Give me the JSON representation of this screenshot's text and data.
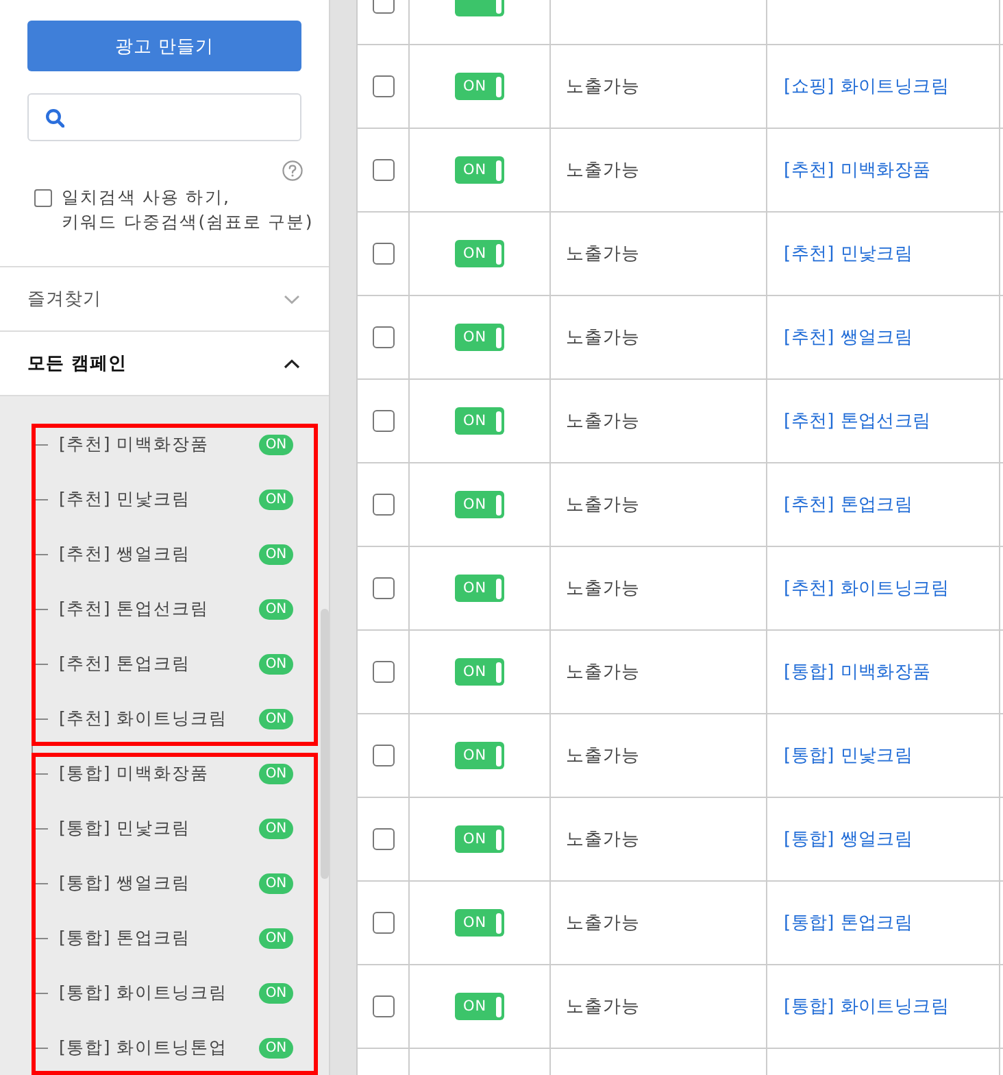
{
  "sidebar": {
    "create_button": "광고 만들기",
    "exact_match": {
      "checked": false,
      "label_lines": [
        "일치검색 사용 하기,",
        "키워드 다중검색(쉼표로 구분)"
      ]
    },
    "sections": [
      {
        "label": "즐겨찾기",
        "expanded": false
      },
      {
        "label": "모든 캠페인",
        "expanded": true,
        "campaign_groups": [
          {
            "highlighted": true,
            "items": [
              {
                "name": "[추천] 미백화장품",
                "on": true,
                "badge": "ON"
              },
              {
                "name": "[추천] 민낯크림",
                "on": true,
                "badge": "ON"
              },
              {
                "name": "[추천] 쌩얼크림",
                "on": true,
                "badge": "ON"
              },
              {
                "name": "[추천] 톤업선크림",
                "on": true,
                "badge": "ON"
              },
              {
                "name": "[추천] 톤업크림",
                "on": true,
                "badge": "ON"
              },
              {
                "name": "[추천] 화이트닝크림",
                "on": true,
                "badge": "ON"
              }
            ]
          },
          {
            "highlighted": true,
            "items": [
              {
                "name": "[통합] 미백화장품",
                "on": true,
                "badge": "ON"
              },
              {
                "name": "[통합] 민낯크림",
                "on": true,
                "badge": "ON"
              },
              {
                "name": "[통합] 쌩얼크림",
                "on": true,
                "badge": "ON"
              },
              {
                "name": "[통합] 톤업크림",
                "on": true,
                "badge": "ON"
              },
              {
                "name": "[통합] 화이트닝크림",
                "on": true,
                "badge": "ON"
              },
              {
                "name": "[통합] 화이트닝톤업",
                "on": true,
                "badge": "ON"
              }
            ]
          }
        ]
      }
    ]
  },
  "table": {
    "rows": [
      {
        "checked": false,
        "on": true
      },
      {
        "checked": false,
        "on": true,
        "toggle_label": "ON",
        "status": "노출가능",
        "campaign": "[쇼핑] 화이트닝크림"
      },
      {
        "checked": false,
        "on": true,
        "toggle_label": "ON",
        "status": "노출가능",
        "campaign": "[추천] 미백화장품"
      },
      {
        "checked": false,
        "on": true,
        "toggle_label": "ON",
        "status": "노출가능",
        "campaign": "[추천] 민낯크림"
      },
      {
        "checked": false,
        "on": true,
        "toggle_label": "ON",
        "status": "노출가능",
        "campaign": "[추천] 쌩얼크림"
      },
      {
        "checked": false,
        "on": true,
        "toggle_label": "ON",
        "status": "노출가능",
        "campaign": "[추천] 톤업선크림"
      },
      {
        "checked": false,
        "on": true,
        "toggle_label": "ON",
        "status": "노출가능",
        "campaign": "[추천] 톤업크림"
      },
      {
        "checked": false,
        "on": true,
        "toggle_label": "ON",
        "status": "노출가능",
        "campaign": "[추천] 화이트닝크림"
      },
      {
        "checked": false,
        "on": true,
        "toggle_label": "ON",
        "status": "노출가능",
        "campaign": "[통합] 미백화장품"
      },
      {
        "checked": false,
        "on": true,
        "toggle_label": "ON",
        "status": "노출가능",
        "campaign": "[통합] 민낯크림"
      },
      {
        "checked": false,
        "on": true,
        "toggle_label": "ON",
        "status": "노출가능",
        "campaign": "[통합] 쌩얼크림"
      },
      {
        "checked": false,
        "on": true,
        "toggle_label": "ON",
        "status": "노출가능",
        "campaign": "[통합] 톤업크림"
      },
      {
        "checked": false,
        "on": true,
        "toggle_label": "ON",
        "status": "노출가능",
        "campaign": "[통합] 화이트닝크림"
      }
    ]
  }
}
